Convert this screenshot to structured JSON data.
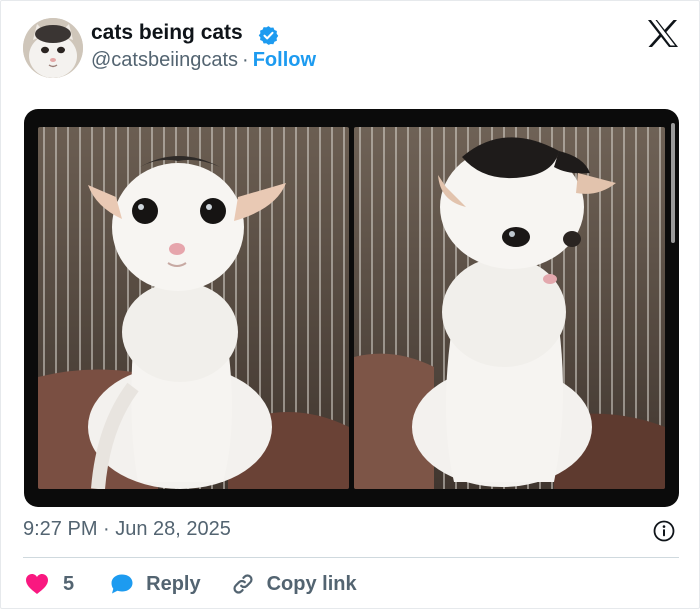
{
  "author": {
    "name": "cats being cats",
    "handle": "@catsbeiingcats",
    "separator": "·",
    "follow_label": "Follow"
  },
  "post": {
    "timestamp": "9:27 PM · Jun 28, 2025"
  },
  "actions": {
    "like_count": "5",
    "reply_label": "Reply",
    "copy_link_label": "Copy link"
  },
  "colors": {
    "accent": "#1d9bf0",
    "like": "#f91880",
    "muted_text": "#536471"
  },
  "icons": [
    "verified-badge-icon",
    "x-logo-icon",
    "info-icon",
    "heart-icon",
    "reply-bubble-icon",
    "link-icon"
  ]
}
